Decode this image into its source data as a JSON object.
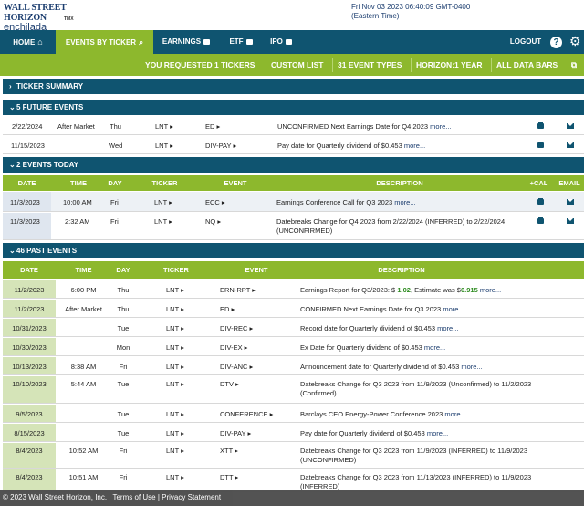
{
  "header": {
    "logo_line1": "WALL STREET HORIZON",
    "logo_line2": "enchilada",
    "logo_tmx": "TMX",
    "datetime": "Fri Nov 03 2023 06:40:09 GMT-0400",
    "timezone": "(Eastern Time)"
  },
  "nav": {
    "home": "HOME",
    "events_by_ticker": "EVENTS BY TICKER",
    "earnings": "EARNINGS",
    "etf": "ETF",
    "ipo": "IPO",
    "logout": "LOGOUT",
    "help": "?"
  },
  "subnav": {
    "requested": "YOU REQUESTED 1 TICKERS",
    "custom_list": "CUSTOM LIST",
    "event_types": "31 EVENT TYPES",
    "horizon": "HORIZON:1 YEAR",
    "all_data_bars": "ALL DATA BARS"
  },
  "sections": {
    "ticker_summary": "TICKER SUMMARY",
    "future": "5 FUTURE EVENTS",
    "today": "2 EVENTS TODAY",
    "past": "46 PAST EVENTS"
  },
  "columns": {
    "date": "DATE",
    "time": "TIME",
    "day": "DAY",
    "ticker": "TICKER",
    "event": "EVENT",
    "description": "DESCRIPTION",
    "cal": "+CAL",
    "email": "EMAIL"
  },
  "future_rows": [
    {
      "date": "2/22/2024",
      "time": "After Market",
      "day": "Thu",
      "ticker": "LNT",
      "event": "ED",
      "desc": "UNCONFIRMED Next Earnings Date for Q4 2023",
      "more": "more..."
    },
    {
      "date": "11/15/2023",
      "time": "",
      "day": "Wed",
      "ticker": "LNT",
      "event": "DIV-PAY",
      "desc": "Pay date for Quarterly dividend of $0.453",
      "more": "more..."
    }
  ],
  "today_rows": [
    {
      "date": "11/3/2023",
      "time": "10:00 AM",
      "day": "Fri",
      "ticker": "LNT",
      "event": "ECC",
      "desc": "Earnings Conference Call for Q3 2023",
      "more": "more..."
    },
    {
      "date": "11/3/2023",
      "time": "2:32 AM",
      "day": "Fri",
      "ticker": "LNT",
      "event": "NQ",
      "desc1": "Datebreaks Change for Q4 2023 from 2/22/2024 (INFERRED) to 2/22/2024",
      "desc2": "(UNCONFIRMED)"
    }
  ],
  "past_rows": [
    {
      "date": "11/2/2023",
      "time": "6:00 PM",
      "day": "Thu",
      "ticker": "LNT",
      "event": "ERN-RPT",
      "desc": "Earnings Report for Q3/2023: $",
      "v1": "1.02",
      "mid": ", Estimate was $",
      "v2": "0.915",
      "more": "more..."
    },
    {
      "date": "11/2/2023",
      "time": "After Market",
      "day": "Thu",
      "ticker": "LNT",
      "event": "ED",
      "desc": "CONFIRMED Next Earnings Date for Q3 2023",
      "more": "more..."
    },
    {
      "date": "10/31/2023",
      "time": "",
      "day": "Tue",
      "ticker": "LNT",
      "event": "DIV-REC",
      "desc": "Record date for Quarterly dividend of $0.453",
      "more": "more..."
    },
    {
      "date": "10/30/2023",
      "time": "",
      "day": "Mon",
      "ticker": "LNT",
      "event": "DIV-EX",
      "desc": "Ex Date for Quarterly dividend of $0.453",
      "more": "more..."
    },
    {
      "date": "10/13/2023",
      "time": "8:38 AM",
      "day": "Fri",
      "ticker": "LNT",
      "event": "DIV-ANC",
      "desc": "Announcement date for Quarterly dividend of $0.453",
      "more": "more..."
    },
    {
      "date": "10/10/2023",
      "time": "5:44 AM",
      "day": "Tue",
      "ticker": "LNT",
      "event": "DTV",
      "desc1": "Datebreaks Change for Q3 2023 from 11/9/2023 (Unconfirmed) to 11/2/2023",
      "desc2": "(Confirmed)"
    },
    {
      "date": "9/5/2023",
      "time": "",
      "day": "Tue",
      "ticker": "LNT",
      "event": "CONFERENCE",
      "desc": "Barclays CEO Energy-Power Conference 2023",
      "more": "more..."
    },
    {
      "date": "8/15/2023",
      "time": "",
      "day": "Tue",
      "ticker": "LNT",
      "event": "DIV-PAY",
      "desc": "Pay date for Quarterly dividend of $0.453",
      "more": "more..."
    },
    {
      "date": "8/4/2023",
      "time": "10:52 AM",
      "day": "Fri",
      "ticker": "LNT",
      "event": "XTT",
      "desc1": "Datebreaks Change for Q3 2023 from 11/9/2023 (INFERRED) to 11/9/2023",
      "desc2": "(UNCONFIRMED)"
    },
    {
      "date": "8/4/2023",
      "time": "10:51 AM",
      "day": "Fri",
      "ticker": "LNT",
      "event": "DTT",
      "desc1": "Datebreaks Change for Q3 2023 from 11/13/2023 (INFERRED) to 11/9/2023",
      "desc2": "(INFERRED)"
    }
  ],
  "footer": {
    "copyright": "© 2023 Wall Street Horizon, Inc.",
    "sep": "|",
    "terms": "Terms of Use",
    "privacy": "Privacy Statement"
  },
  "colors": {
    "navy": "#0f5470",
    "green": "#8db82d"
  }
}
